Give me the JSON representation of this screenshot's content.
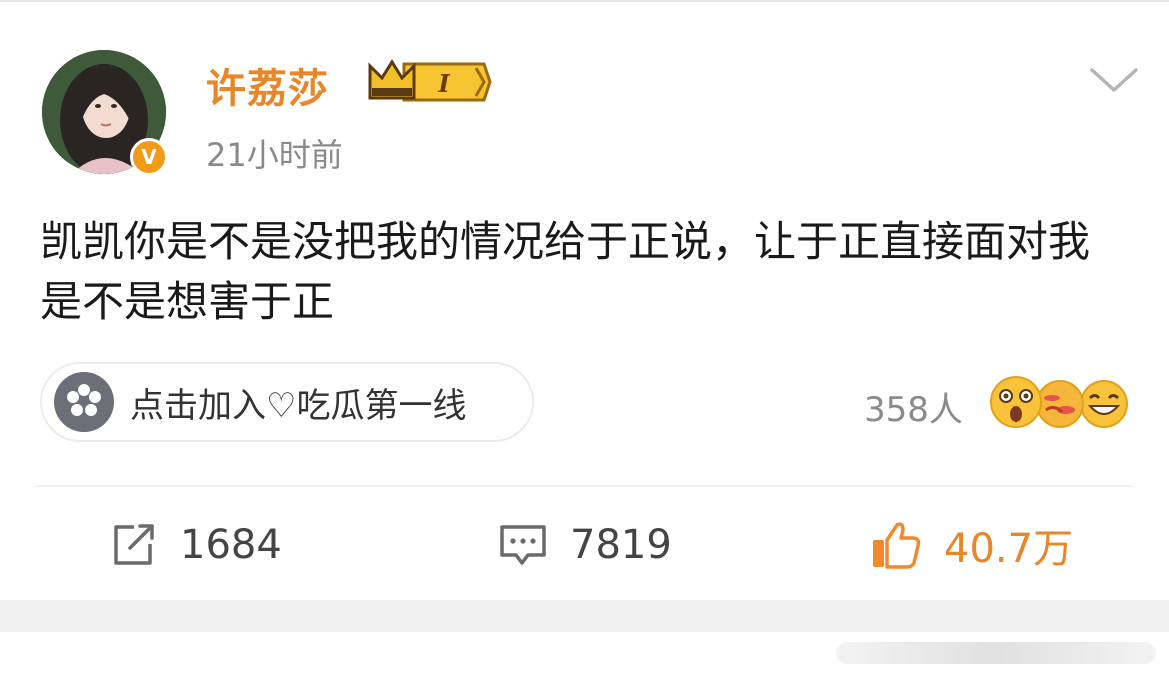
{
  "post": {
    "username": "许荔莎",
    "vip_level": "I",
    "time": "21小时前",
    "text": "凯凯你是不是没把我的情况给于正说，让于正直接面对我是不是想害于正",
    "verified_mark": "V"
  },
  "topic": {
    "label": "点击加入♡吃瓜第一线",
    "icon": "flower-icon"
  },
  "reactions": {
    "count_label": "358人",
    "emojis": [
      "shocked-emoji",
      "kiss-emoji",
      "laughing-emoji"
    ]
  },
  "actions": {
    "repost_count": "1684",
    "comment_count": "7819",
    "like_count": "40.7万"
  },
  "colors": {
    "accent": "#e8862a",
    "muted": "#8a8a8a"
  }
}
